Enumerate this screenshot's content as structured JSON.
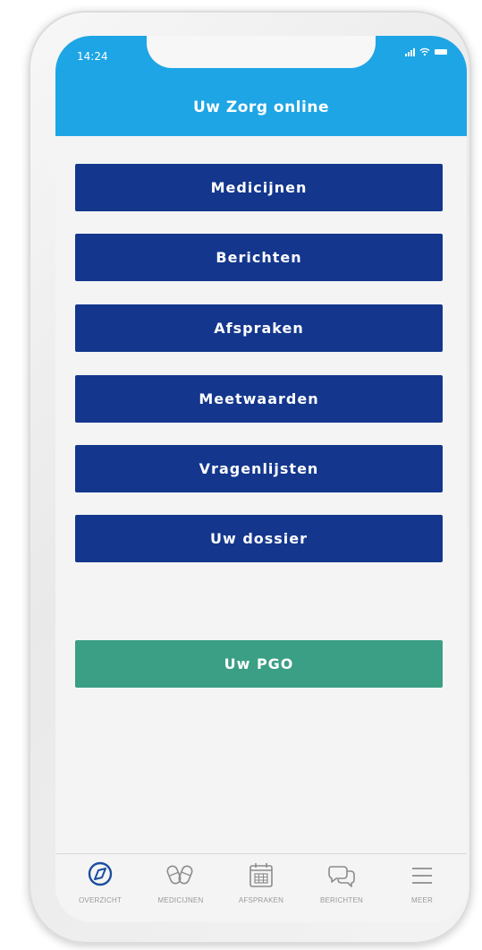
{
  "status_bar": {
    "time": "14:24"
  },
  "header": {
    "title": "Uw Zorg online"
  },
  "menu": {
    "items": [
      {
        "label": "Medicijnen"
      },
      {
        "label": "Berichten"
      },
      {
        "label": "Afspraken"
      },
      {
        "label": "Meetwaarden"
      },
      {
        "label": "Vragenlijsten"
      },
      {
        "label": "Uw dossier"
      }
    ],
    "pgo_label": "Uw PGO"
  },
  "tabbar": {
    "tabs": [
      {
        "label": "OVERZICHT",
        "icon": "compass-icon"
      },
      {
        "label": "MEDICIJNEN",
        "icon": "pills-icon"
      },
      {
        "label": "AFSPRAKEN",
        "icon": "calendar-icon"
      },
      {
        "label": "BERICHTEN",
        "icon": "chat-bubbles-icon"
      },
      {
        "label": "MEER",
        "icon": "menu-icon"
      }
    ]
  },
  "colors": {
    "header": "#1ea5e5",
    "menu_button": "#14378d",
    "pgo_button": "#3a9f84",
    "tab_active": "#1b4ea0",
    "tab_inactive": "#8c8c8c"
  }
}
